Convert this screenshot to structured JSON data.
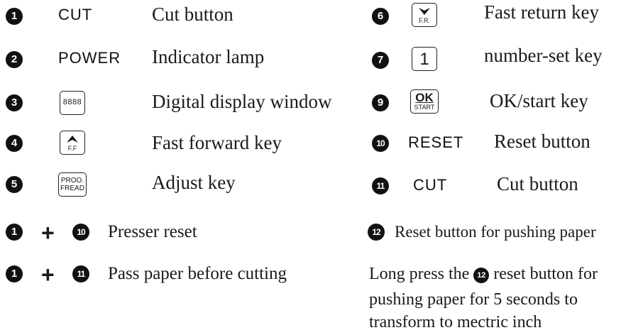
{
  "left_items": [
    {
      "num": "1",
      "code": "CUT",
      "desc": "Cut button"
    },
    {
      "num": "2",
      "code": "POWER",
      "desc": "Indicator lamp"
    },
    {
      "num": "3",
      "key_text": "8888",
      "desc": "Digital display window"
    },
    {
      "num": "4",
      "key_sub": "F.F",
      "desc": "Fast forward key"
    },
    {
      "num": "5",
      "key_line1": "PROO.",
      "key_line2": "FREAD",
      "desc": "Adjust key"
    }
  ],
  "right_items": [
    {
      "num": "6",
      "key_sub": "F.R.",
      "desc": "Fast return key"
    },
    {
      "num": "7",
      "key_text": "1",
      "desc": "number-set key"
    },
    {
      "num": "9",
      "key_main": "OK",
      "key_sub": "START",
      "desc": "OK/start key"
    },
    {
      "num": "10",
      "code": "RESET",
      "desc": "Reset button"
    },
    {
      "num": "11",
      "code": "CUT",
      "desc": "Cut button"
    }
  ],
  "combos": [
    {
      "a": "1",
      "plus": "+",
      "b": "10",
      "desc": "Presser reset"
    },
    {
      "a": "1",
      "plus": "+",
      "b": "11",
      "desc": "Pass paper before cutting"
    }
  ],
  "reset_push": {
    "num": "12",
    "desc": "Reset button for pushing paper"
  },
  "long_press": {
    "before": "Long press the",
    "num": "12",
    "after": "reset button for",
    "line2": "pushing paper for 5 seconds to",
    "line3": "transform to mectric inch"
  }
}
